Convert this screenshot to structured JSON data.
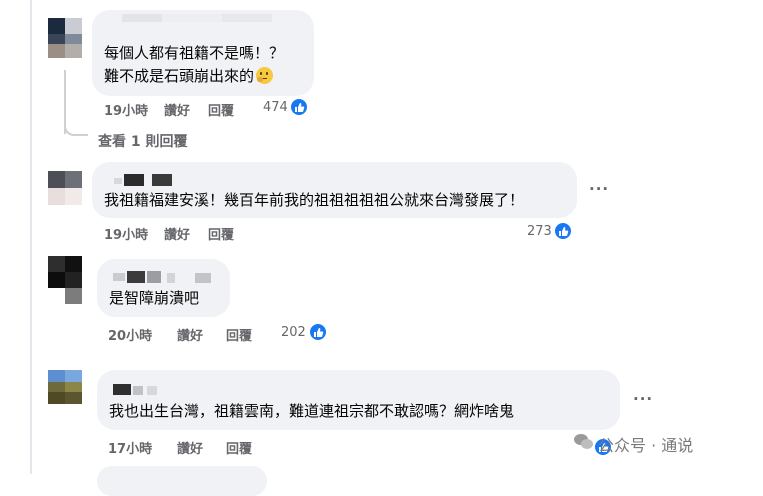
{
  "comments": [
    {
      "text_lines": [
        "每個人都有祖籍不是嗎！？",
        "難不成是石頭崩出來的"
      ],
      "emoji": "thinking-face",
      "time": "19小時",
      "like_label": "讚好",
      "reply_label": "回覆",
      "reactions": "474",
      "view_replies": "查看 1 則回覆"
    },
    {
      "text_lines": [
        "我祖籍福建安溪！幾百年前我的祖祖祖祖祖公就來台灣發展了！"
      ],
      "time": "19小時",
      "like_label": "讚好",
      "reply_label": "回覆",
      "reactions": "273"
    },
    {
      "text_lines": [
        "是智障崩潰吧"
      ],
      "time": "20小時",
      "like_label": "讚好",
      "reply_label": "回覆",
      "reactions": "202"
    },
    {
      "text_lines": [
        "我也出生台灣，祖籍雲南，難道連祖宗都不敢認嗎？網炸啥鬼"
      ],
      "time": "17小時",
      "like_label": "讚好",
      "reply_label": "回覆"
    }
  ],
  "more_label": "···",
  "watermark": "公众号 · 通说",
  "colors": {
    "bubble": "#f0f2f5",
    "meta_text": "#65676b",
    "like_blue": "#1877f2",
    "thread_line": "#ced0d4"
  }
}
